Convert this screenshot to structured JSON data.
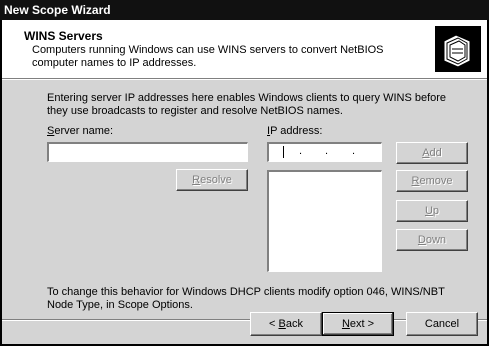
{
  "window": {
    "title": "New Scope Wizard"
  },
  "header": {
    "title": "WINS Servers",
    "subtitle": "Computers running Windows can use WINS servers to convert NetBIOS computer names to IP addresses.",
    "icon": "folders-icon"
  },
  "body": {
    "intro": "Entering server IP addresses here enables Windows clients to query WINS before they use broadcasts to register and resolve NetBIOS names.",
    "server_name_label_prefix": "S",
    "server_name_label_rest": "erver name:",
    "server_name_value": "",
    "ip_label_prefix": "I",
    "ip_label_rest": "P address:",
    "ip_value": " .   .   .",
    "resolve_prefix": "R",
    "resolve_rest": "esolve",
    "add_prefix": "A",
    "add_rest": "dd",
    "remove_prefix": "R",
    "remove_rest": "emove",
    "up_prefix": "U",
    "up_rest": "p",
    "down_prefix": "D",
    "down_rest": "own",
    "footer": "To change this behavior for Windows DHCP clients modify option 046, WINS/NBT Node Type, in Scope Options."
  },
  "buttons": {
    "back_prefix": "< ",
    "back_u": "B",
    "back_rest": "ack",
    "next_u": "N",
    "next_rest": "ext >",
    "cancel": "Cancel"
  }
}
